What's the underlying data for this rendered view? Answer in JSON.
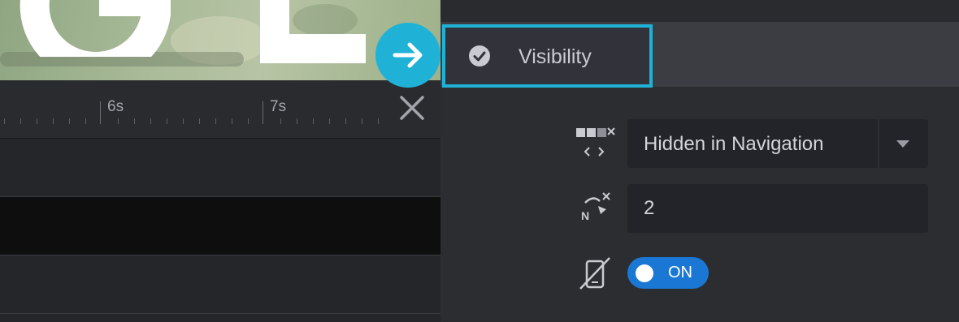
{
  "timeline": {
    "tick_labels": [
      "6s",
      "7s"
    ]
  },
  "panel": {
    "active_tab": {
      "label": "Visibility",
      "icon": "check-circle-icon"
    },
    "navigation_visibility": {
      "value": "Hidden in Navigation",
      "icon": "hide-navigation-icon"
    },
    "slide_count": {
      "value": "2",
      "icon": "next-count-icon"
    },
    "mobile_toggle": {
      "state_label": "ON",
      "icon": "hide-on-mobile-icon",
      "on": true
    }
  },
  "colors": {
    "accent": "#1fb2d6",
    "toggle_on": "#1a78d4",
    "panel_bg": "#2c2d31"
  }
}
